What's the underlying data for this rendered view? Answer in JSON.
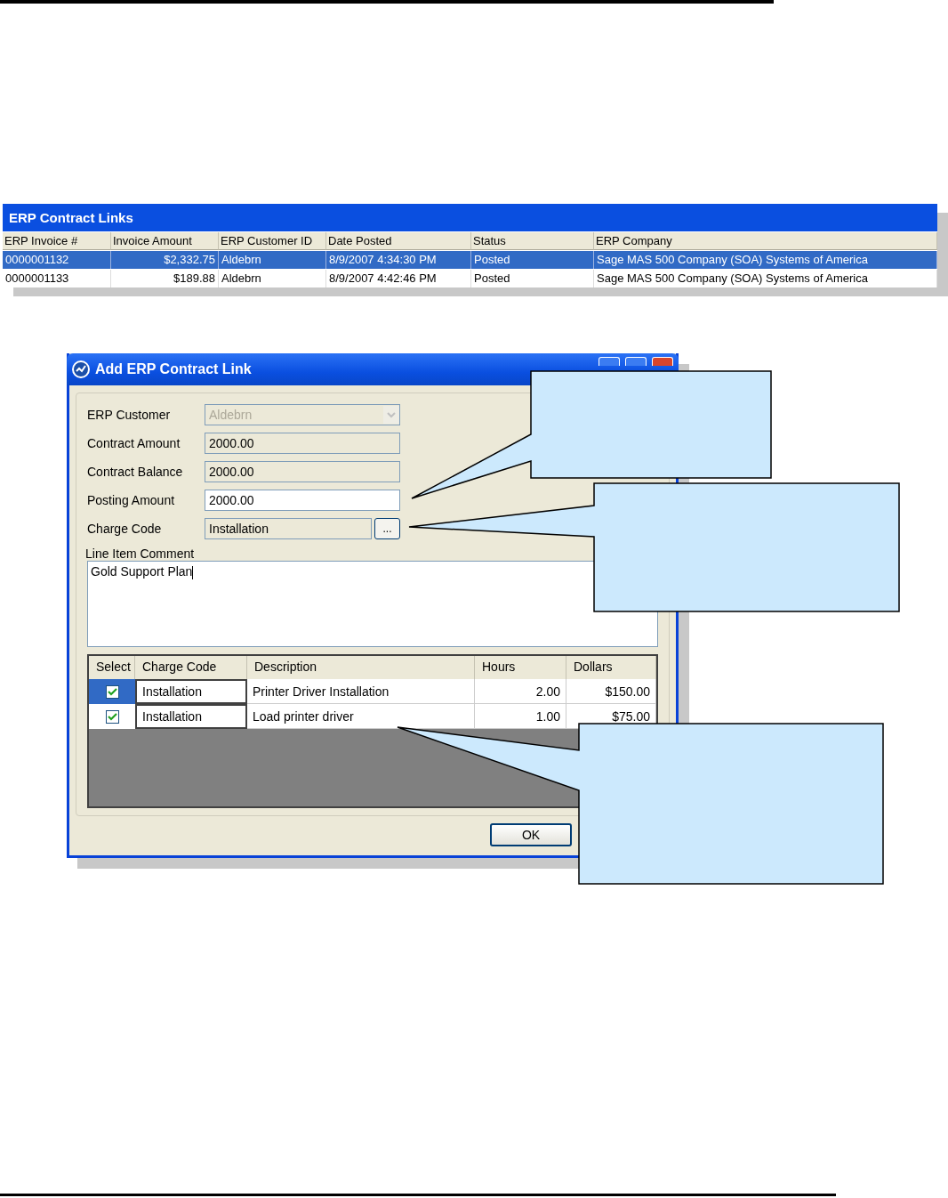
{
  "grid": {
    "title": "ERP Contract Links",
    "columns": [
      "ERP Invoice #",
      "Invoice Amount",
      "ERP Customer ID",
      "Date Posted",
      "Status",
      "ERP Company"
    ],
    "rows": [
      {
        "selected": true,
        "cells": [
          "0000001132",
          "$2,332.75",
          "Aldebrn",
          "8/9/2007 4:34:30 PM",
          "Posted",
          "Sage MAS 500 Company (SOA) Systems of America"
        ]
      },
      {
        "selected": false,
        "cells": [
          "0000001133",
          "$189.88",
          "Aldebrn",
          "8/9/2007 4:42:46 PM",
          "Posted",
          "Sage MAS 500 Company (SOA) Systems of America"
        ]
      }
    ]
  },
  "dialog": {
    "title": "Add ERP Contract Link",
    "fields": [
      {
        "label": "ERP Customer",
        "value": "Aldebrn",
        "kind": "combo",
        "disabled": true
      },
      {
        "label": "Contract Amount",
        "value": "2000.00",
        "kind": "text",
        "disabled": true
      },
      {
        "label": "Contract Balance",
        "value": "2000.00",
        "kind": "text",
        "disabled": true
      },
      {
        "label": "Posting Amount",
        "value": "2000.00",
        "kind": "text",
        "disabled": false
      },
      {
        "label": "Charge Code",
        "value": "Installation",
        "kind": "lookup",
        "disabled": true,
        "button": "..."
      }
    ],
    "comment": {
      "label": "Line Item Comment",
      "value": "Gold Support Plan"
    },
    "lines": {
      "columns": [
        "Select",
        "Charge Code",
        "Description",
        "Hours",
        "Dollars"
      ],
      "rows": [
        {
          "selected": true,
          "checked": true,
          "charge_code": "Installation",
          "description": "Printer Driver Installation",
          "hours": "2.00",
          "dollars": "$150.00"
        },
        {
          "selected": false,
          "checked": true,
          "charge_code": "Installation",
          "description": "Load printer driver",
          "hours": "1.00",
          "dollars": "$75.00"
        }
      ]
    },
    "ok_button": "OK"
  }
}
